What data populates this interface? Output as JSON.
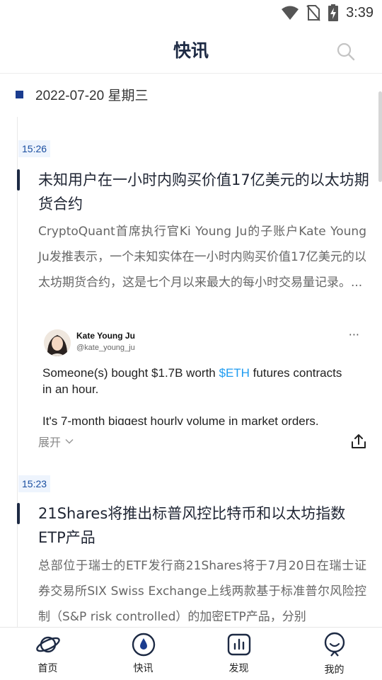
{
  "status_bar": {
    "time": "3:39"
  },
  "header": {
    "title": "快讯"
  },
  "date_group": {
    "date": "2022-07-20 星期三"
  },
  "news": [
    {
      "time": "15:26",
      "title": "未知用户在一小时内购买价值17亿美元的以太坊期货合约",
      "body": "CryptoQuant首席执行官Ki Young Ju的子账户Kate Young Ju发推表示，一个未知实体在一小时内购买价值17亿美元的以太坊期货合约，这是七个月以来最大的每小时交易量记录。...",
      "tweet": {
        "name": "Kate Young Ju",
        "handle": "@kate_young_ju",
        "more": "···",
        "text_before_link": "Someone(s) bought $1.7B worth ",
        "link": "$ETH",
        "text_after_link": " futures contracts in an hour.",
        "text_second": "It's 7-month biggest hourly volume in market orders."
      },
      "expand_label": "展开"
    },
    {
      "time": "15:23",
      "title": "21Shares将推出标普风控比特币和以太坊指数ETP产品",
      "body": "总部位于瑞士的ETF发行商21Shares将于7月20日在瑞士证券交易所SIX Swiss Exchange上线两款基于标准普尔风险控制（S&P risk controlled）的加密ETP产品，分别"
    }
  ],
  "bottom_nav": [
    {
      "label": "首页",
      "icon": "planet-icon"
    },
    {
      "label": "快讯",
      "icon": "flash-drop-icon"
    },
    {
      "label": "发现",
      "icon": "bar-chart-icon"
    },
    {
      "label": "我的",
      "icon": "profile-face-icon"
    }
  ],
  "colors": {
    "accent": "#1a3c8f",
    "time_tag_bg": "#eef4fd",
    "time_tag_text": "#1a4ea0",
    "link": "#1d9bf0"
  }
}
